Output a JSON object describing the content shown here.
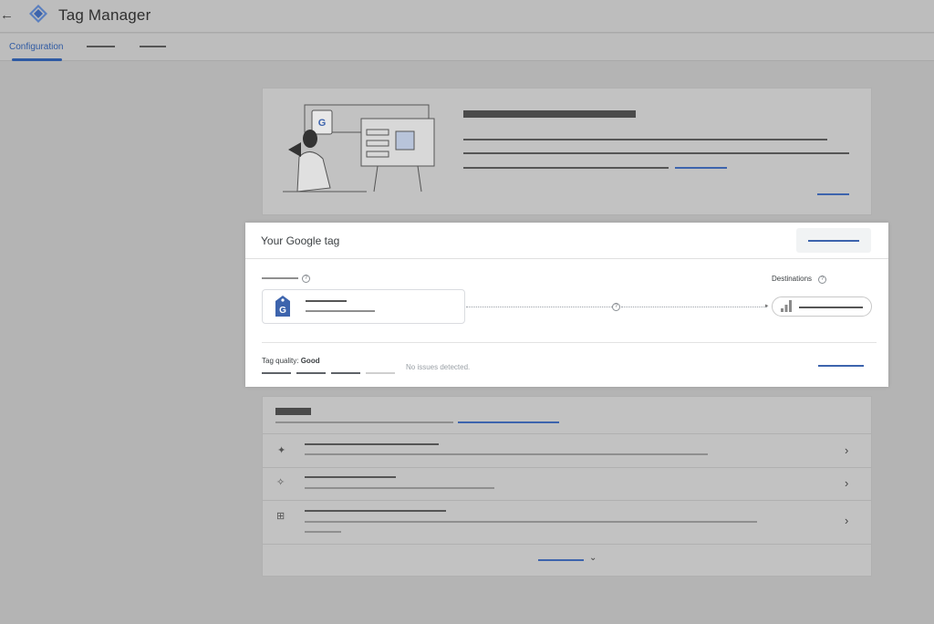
{
  "header": {
    "back_glyph": "←",
    "logo_icon": "tag-manager-logo-icon",
    "app_title": "Tag Manager"
  },
  "tabs": {
    "active_label": "Configuration"
  },
  "google_tag_card": {
    "title": "Your Google tag",
    "destinations_label": "Destinations",
    "help_glyph": "?",
    "tag_icon": "google-tag-icon",
    "destination_icon": "analytics-bars-icon",
    "quality_label": "Tag quality:",
    "quality_value": "Good",
    "quality_message": "No issues detected."
  },
  "list_rows": [
    {
      "icon": "sparkle-icon",
      "glyph": "✦"
    },
    {
      "icon": "sparkles-icon",
      "glyph": "✧"
    },
    {
      "icon": "grid-icon",
      "glyph": "⊞"
    }
  ],
  "chevron_glyph": "›",
  "colors": {
    "accent": "#2f5aa3",
    "overlay": "#b4b4b4",
    "highlight_card": "#ffffff"
  }
}
